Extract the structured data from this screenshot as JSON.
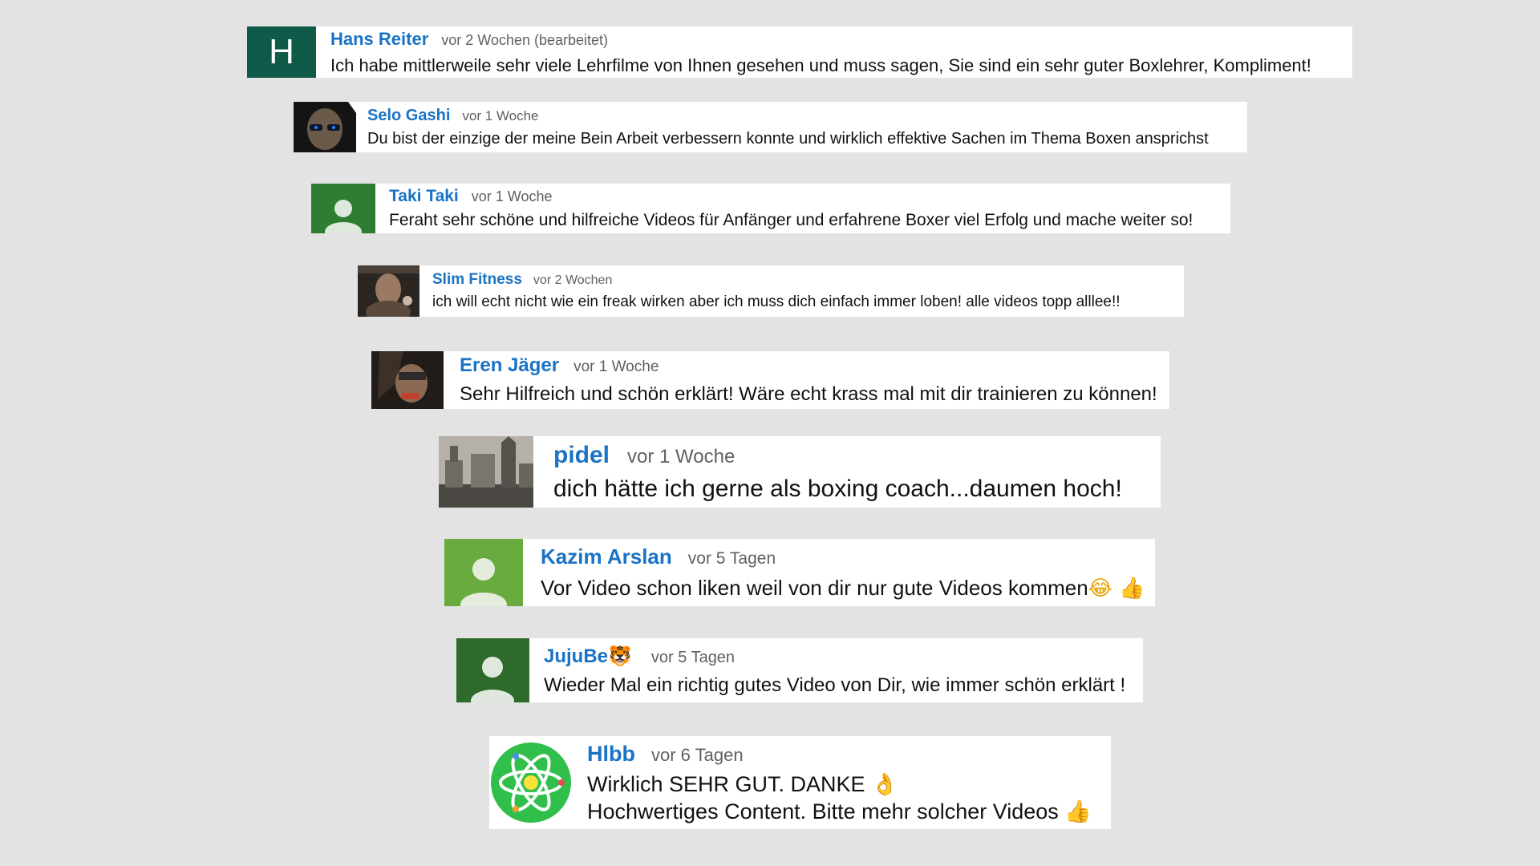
{
  "comments": [
    {
      "author": "Hans Reiter",
      "time": "vor 2 Wochen (bearbeitet)",
      "text": "Ich habe mittlerweile sehr viele Lehrfilme von Ihnen gesehen und muss sagen, Sie sind ein sehr guter Boxlehrer, Kompliment!",
      "avatar": {
        "type": "letter",
        "letter": "H",
        "bg": "#0f5a48"
      }
    },
    {
      "author": "Selo Gashi",
      "time": "vor 1 Woche",
      "text": "Du bist der einzige der meine Bein Arbeit verbessern konnte und wirklich effektive Sachen im Thema Boxen ansprichst",
      "avatar": {
        "type": "photo",
        "bg": "#1a1a1a"
      }
    },
    {
      "author": "Taki Taki",
      "time": "vor 1 Woche",
      "text": "Feraht sehr schöne und hilfreiche Videos für Anfänger und erfahrene Boxer viel Erfolg und mache weiter so!",
      "avatar": {
        "type": "default",
        "bg": "#2e7d32"
      }
    },
    {
      "author": "Slim Fitness",
      "time": "vor 2 Wochen",
      "text": "ich will echt nicht wie ein freak wirken aber ich muss dich einfach immer loben! alle videos topp alllee!!",
      "avatar": {
        "type": "photo",
        "bg": "#3a3530"
      }
    },
    {
      "author": "Eren Jäger",
      "time": "vor 1 Woche",
      "text": "Sehr Hilfreich und schön erklärt! Wäre echt krass mal mit dir trainieren zu können!",
      "avatar": {
        "type": "photo",
        "bg": "#2b2420"
      }
    },
    {
      "author": "pidel",
      "time": "vor 1 Woche",
      "text": "dich hätte ich gerne als boxing coach...daumen hoch!",
      "avatar": {
        "type": "photo",
        "bg": "#8a8580"
      }
    },
    {
      "author": "Kazim Arslan",
      "time": "vor 5 Tagen",
      "text": "Vor Video schon liken weil von dir nur gute Videos kommen",
      "emoji": "😂 👍",
      "avatar": {
        "type": "default",
        "bg": "#6aab3f"
      }
    },
    {
      "author": "JujuBe",
      "author_emoji": "🐯",
      "time": "vor 5 Tagen",
      "text": "Wieder Mal ein richtig gutes Video von Dir, wie immer schön erklärt !",
      "avatar": {
        "type": "default",
        "bg": "#2e6b2a"
      }
    },
    {
      "author": "Hlbb",
      "time": "vor 6 Tagen",
      "text": "Wirklich SEHR GUT. DANKE",
      "text_emoji": "👌",
      "text2": "Hochwertiges Content. Bitte mehr solcher Videos",
      "text2_emoji": "👍",
      "avatar": {
        "type": "atom",
        "bg": "#2fbf4a"
      }
    }
  ]
}
